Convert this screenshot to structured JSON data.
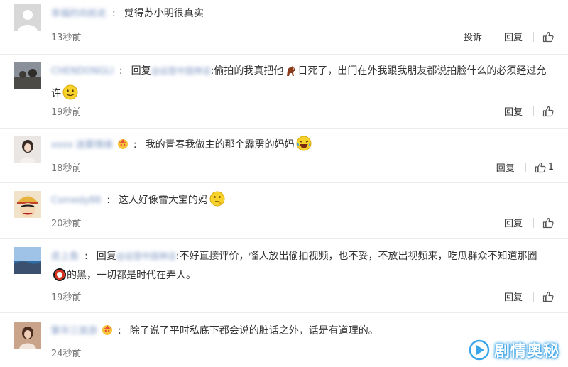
{
  "labels": {
    "reply": "回复",
    "report": "投诉",
    "reply_prefix": "回复"
  },
  "comments": [
    {
      "username": "幸福的向前走",
      "text": "觉得苏小明很真实",
      "time": "13秒前",
      "likes": ""
    },
    {
      "username": "CHENDONGLI",
      "reply_to": "@运营中国神话",
      "text_a": ":偷拍的我真把他",
      "text_b": "日死了，出门在外我跟我朋友都说拍脸什么的必须经过允许",
      "time": "19秒前",
      "likes": ""
    },
    {
      "username": "xxxx 迷雾情缘",
      "text": "我的青春我做主的那个霹雳的妈妈",
      "time": "18秒前",
      "likes": "1"
    },
    {
      "username": "Comedy88",
      "text": "这人好像雷大宝的妈",
      "time": "20秒前",
      "likes": ""
    },
    {
      "username": "皮上鱼",
      "reply_to": "@运营中国神话",
      "text_a": ":不好直接评价，怪人放出偷拍视频，也不妥，不放出视频来，吃瓜群众不知道那圈",
      "text_b": "的黑，一切都是时代在弄人。",
      "time": "19秒前",
      "likes": ""
    },
    {
      "username": "繁华三旅游",
      "text": "除了说了平时私底下都会说的脏话之外，话是有道理的。",
      "time": "24秒前",
      "likes": ""
    }
  ],
  "watermark": {
    "text": "剧情奥秘"
  },
  "colors": {
    "link": "#6e86b9",
    "time": "#757575",
    "divider": "#ececec"
  }
}
